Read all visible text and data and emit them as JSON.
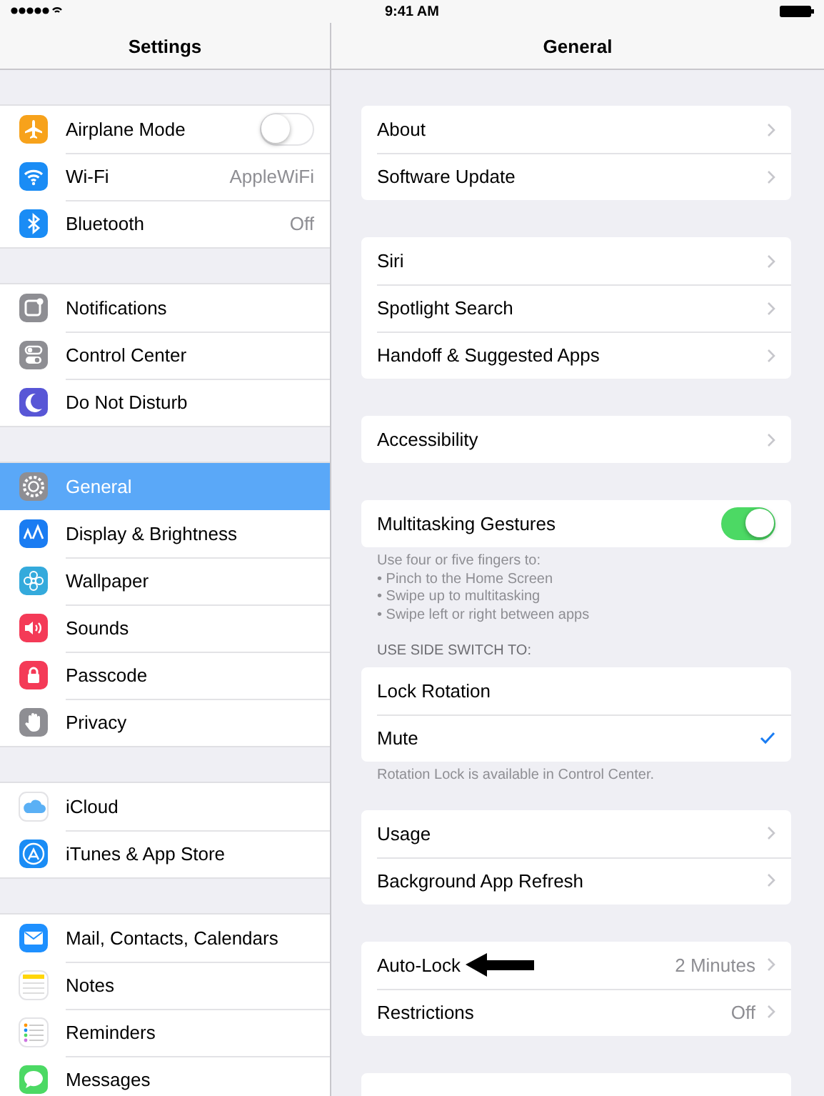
{
  "status_bar": {
    "time": "9:41 AM"
  },
  "sidebar": {
    "title": "Settings",
    "groups": [
      {
        "items": [
          {
            "label": "Airplane Mode",
            "kind": "toggle",
            "on": false,
            "selected": false
          },
          {
            "label": "Wi-Fi",
            "kind": "value",
            "value": "AppleWiFi",
            "selected": false
          },
          {
            "label": "Bluetooth",
            "kind": "value",
            "value": "Off",
            "selected": false
          }
        ]
      },
      {
        "items": [
          {
            "label": "Notifications",
            "kind": "plain",
            "selected": false
          },
          {
            "label": "Control Center",
            "kind": "plain",
            "selected": false
          },
          {
            "label": "Do Not Disturb",
            "kind": "plain",
            "selected": false
          }
        ]
      },
      {
        "items": [
          {
            "label": "General",
            "kind": "plain",
            "selected": true
          },
          {
            "label": "Display & Brightness",
            "kind": "plain",
            "selected": false
          },
          {
            "label": "Wallpaper",
            "kind": "plain",
            "selected": false
          },
          {
            "label": "Sounds",
            "kind": "plain",
            "selected": false
          },
          {
            "label": "Passcode",
            "kind": "plain",
            "selected": false
          },
          {
            "label": "Privacy",
            "kind": "plain",
            "selected": false
          }
        ]
      },
      {
        "items": [
          {
            "label": "iCloud",
            "kind": "plain",
            "selected": false
          },
          {
            "label": "iTunes & App Store",
            "kind": "plain",
            "selected": false
          }
        ]
      },
      {
        "items": [
          {
            "label": "Mail, Contacts, Calendars",
            "kind": "plain",
            "selected": false
          },
          {
            "label": "Notes",
            "kind": "plain",
            "selected": false
          },
          {
            "label": "Reminders",
            "kind": "plain",
            "selected": false
          },
          {
            "label": "Messages",
            "kind": "plain",
            "selected": false
          }
        ]
      }
    ]
  },
  "detail": {
    "title": "General",
    "sections": [
      {
        "rows": [
          {
            "label": "About",
            "kind": "disclosure",
            "arrow": false
          },
          {
            "label": "Software Update",
            "kind": "disclosure",
            "arrow": false
          }
        ]
      },
      {
        "rows": [
          {
            "label": "Siri",
            "kind": "disclosure",
            "arrow": false
          },
          {
            "label": "Spotlight Search",
            "kind": "disclosure",
            "arrow": false
          },
          {
            "label": "Handoff & Suggested Apps",
            "kind": "disclosure",
            "arrow": false
          }
        ]
      },
      {
        "rows": [
          {
            "label": "Accessibility",
            "kind": "disclosure",
            "arrow": false
          }
        ]
      },
      {
        "rows": [
          {
            "label": "Multitasking Gestures",
            "kind": "toggle",
            "on": true,
            "arrow": false
          }
        ],
        "footer": [
          "Use four or five fingers to:",
          "• Pinch to the Home Screen",
          "• Swipe up to multitasking",
          "• Swipe left or right between apps"
        ]
      },
      {
        "header": "USE SIDE SWITCH TO:",
        "rows": [
          {
            "label": "Lock Rotation",
            "kind": "option",
            "checked": false,
            "arrow": false
          },
          {
            "label": "Mute",
            "kind": "option",
            "checked": true,
            "arrow": false
          }
        ],
        "footer": [
          "Rotation Lock is available in Control Center."
        ]
      },
      {
        "rows": [
          {
            "label": "Usage",
            "kind": "disclosure",
            "arrow": false
          },
          {
            "label": "Background App Refresh",
            "kind": "disclosure",
            "arrow": false
          }
        ]
      },
      {
        "rows": [
          {
            "label": "Auto-Lock",
            "kind": "disclosure",
            "value": "2 Minutes",
            "arrow": true
          },
          {
            "label": "Restrictions",
            "kind": "disclosure",
            "value": "Off",
            "arrow": false
          }
        ]
      }
    ]
  }
}
